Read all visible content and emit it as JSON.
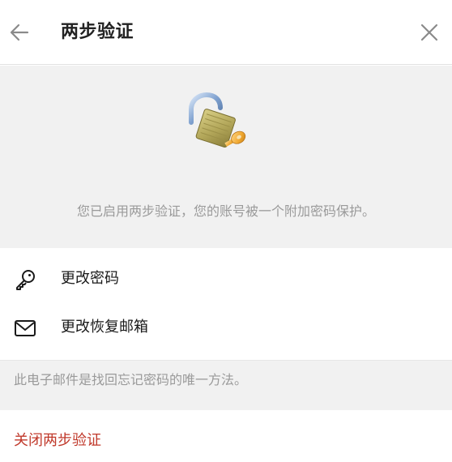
{
  "header": {
    "title": "两步验证",
    "back_icon": "arrow-left-icon",
    "close_icon": "close-icon"
  },
  "intro": {
    "illustration": "padlock-with-key-icon",
    "description": "您已启用两步验证，您的账号被一个附加密码保护。"
  },
  "settings": {
    "items": [
      {
        "icon": "key-icon",
        "label": "更改密码"
      },
      {
        "icon": "mail-icon",
        "label": "更改恢复邮箱"
      }
    ]
  },
  "hint": {
    "text": "此电子邮件是找回忘记密码的唯一方法。"
  },
  "danger_action": {
    "label": "关闭两步验证",
    "color": "#c0392b"
  },
  "colors": {
    "section_background": "#f1f1f1",
    "secondary_text": "#9a9a9a",
    "primary_text": "#1a1a1a",
    "icon_gray": "#8a8a8a"
  }
}
